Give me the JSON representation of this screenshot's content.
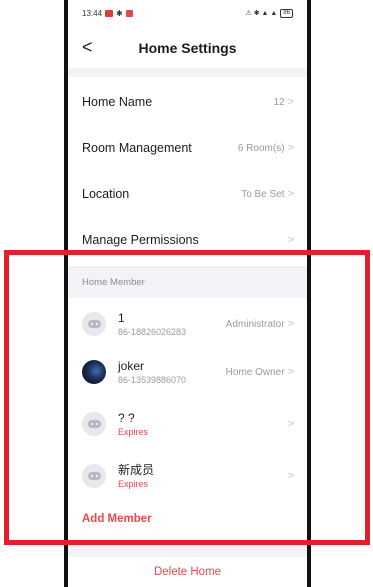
{
  "status_bar": {
    "time": "13:44",
    "right_icons": "⚠ ✱ ▲ ▲",
    "battery": "86"
  },
  "header": {
    "title": "Home Settings",
    "back_icon": "chevron-left-icon"
  },
  "settings": [
    {
      "label": "Home Name",
      "value": "12"
    },
    {
      "label": "Room Management",
      "value": "6 Room(s)"
    },
    {
      "label": "Location",
      "value": "To Be Set"
    },
    {
      "label": "Manage Permissions",
      "value": ""
    }
  ],
  "members_section": {
    "header": "Home Member",
    "members": [
      {
        "name": "1",
        "sub": "86-18826026283",
        "role": "Administrator",
        "avatar": "default-avatar-icon"
      },
      {
        "name": "joker",
        "sub": "86-13539886070",
        "role": "Home Owner",
        "avatar": "photo-avatar"
      },
      {
        "name": "? ?",
        "sub": "Expires",
        "role": "",
        "avatar": "default-avatar-icon"
      },
      {
        "name": "新成员",
        "sub": "Expires",
        "role": "",
        "avatar": "default-avatar-icon"
      }
    ],
    "add_member": "Add Member"
  },
  "delete_home": "Delete Home",
  "colors": {
    "accent_red": "#e5484d",
    "highlight_box": "#e41f2b",
    "section_bg": "#f2f3f6"
  }
}
